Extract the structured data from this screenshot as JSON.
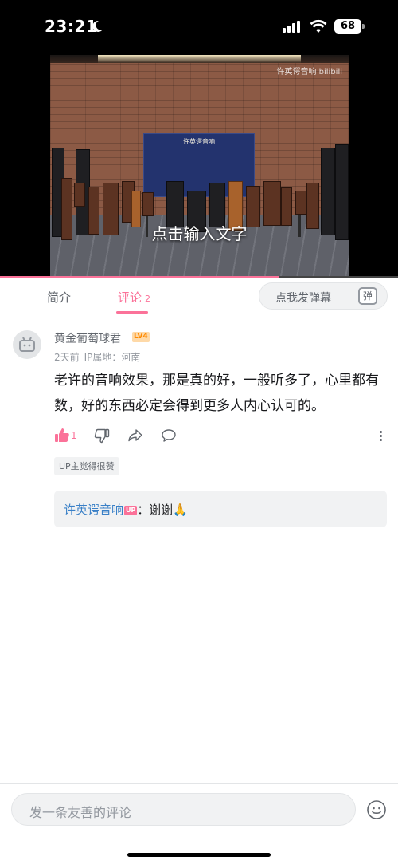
{
  "status_bar": {
    "time": "23:21",
    "battery": "68"
  },
  "video": {
    "watermark": "许英谔音响 bilibili",
    "overlay_text": "点击输入文字",
    "backdrop_title": "许英谔音响",
    "progress": 0.7
  },
  "tabs": {
    "intro_label": "简介",
    "comments_label": "评论",
    "comments_count": "2",
    "danmaku_placeholder": "点我发弹幕",
    "danmaku_icon_label": "弹"
  },
  "comment": {
    "username": "黄金葡萄球君",
    "level": "LV4",
    "time": "2天前",
    "location": "IP属地：河南",
    "content": "老许的音响效果，那是真的好，一般听多了，心里都有数，好的东西必定会得到更多人内心认可的。",
    "like_count": "1",
    "up_badge": "UP主觉得很赞",
    "reply": {
      "user": "许英谔音响",
      "up_tag": "UP",
      "text": "：谢谢🙏"
    }
  },
  "bottom": {
    "input_placeholder": "发一条友善的评论"
  },
  "colors": {
    "accent": "#fb7299",
    "link": "#3a80c7"
  }
}
